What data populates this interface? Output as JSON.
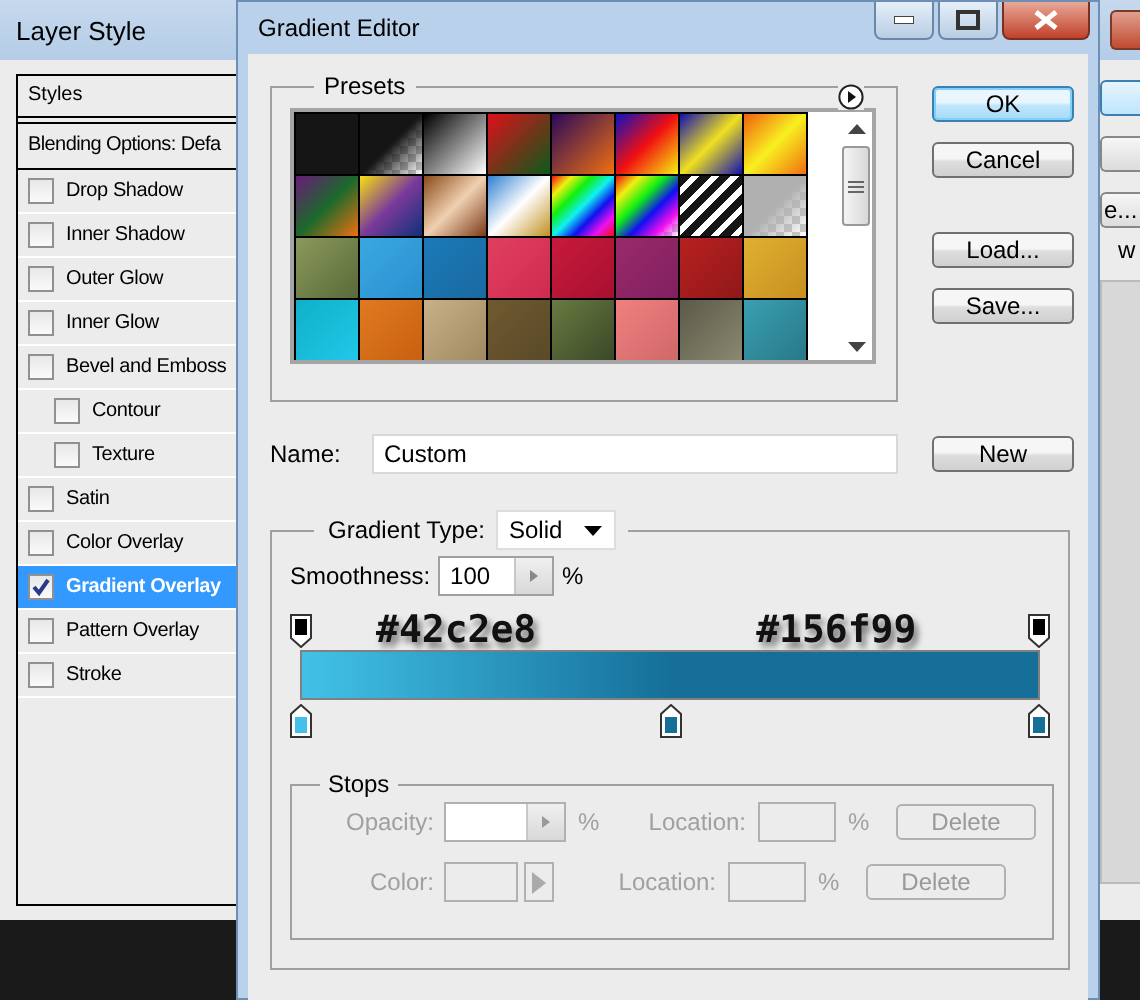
{
  "layer_style": {
    "title": "Layer Style",
    "styles_label": "Styles",
    "blending_options": "Blending Options: Defa",
    "effects": [
      {
        "label": "Drop Shadow",
        "kind": "effect",
        "checked": false,
        "selected": false
      },
      {
        "label": "Inner Shadow",
        "kind": "effect",
        "checked": false,
        "selected": false
      },
      {
        "label": "Outer Glow",
        "kind": "effect",
        "checked": false,
        "selected": false
      },
      {
        "label": "Inner Glow",
        "kind": "effect",
        "checked": false,
        "selected": false
      },
      {
        "label": "Bevel and Emboss",
        "kind": "effect",
        "checked": false,
        "selected": false
      },
      {
        "label": "Contour",
        "kind": "sub",
        "checked": false,
        "selected": false
      },
      {
        "label": "Texture",
        "kind": "sub",
        "checked": false,
        "selected": false
      },
      {
        "label": "Satin",
        "kind": "effect",
        "checked": false,
        "selected": false
      },
      {
        "label": "Color Overlay",
        "kind": "effect",
        "checked": false,
        "selected": false
      },
      {
        "label": "Gradient Overlay",
        "kind": "effect",
        "checked": true,
        "selected": true
      },
      {
        "label": "Pattern Overlay",
        "kind": "effect",
        "checked": false,
        "selected": false
      },
      {
        "label": "Stroke",
        "kind": "effect",
        "checked": false,
        "selected": false
      }
    ],
    "side_button": "e...",
    "side_text": "w"
  },
  "gradient_editor": {
    "title": "Gradient Editor",
    "presets": {
      "title": "Presets"
    },
    "buttons": [
      {
        "label": "OK",
        "default": true
      },
      {
        "label": "Cancel",
        "default": false
      },
      {
        "label": "Load...",
        "default": false
      },
      {
        "label": "Save...",
        "default": false
      }
    ],
    "name": {
      "label": "Name:",
      "value": "Custom",
      "button": "New"
    },
    "gradient": {
      "type_label": "Gradient Type:",
      "type_value": "Solid",
      "smoothness_label": "Smoothness:",
      "smoothness_value": "100",
      "unit": "%",
      "annotations": [
        "#42c2e8",
        "#156f99"
      ],
      "opacity_stops": [
        {
          "level": 0,
          "color": "#000000"
        },
        {
          "level": 1,
          "color": "#000000"
        }
      ],
      "color_stops": [
        {
          "level": 0,
          "color": "#42c2e8"
        },
        {
          "level": 0.5,
          "color": "#156f99"
        },
        {
          "level": 1,
          "color": "#156f99"
        }
      ]
    },
    "stops": {
      "title": "Stops",
      "disabled": true,
      "rows": [
        {
          "kind": "spinner",
          "label": "Opacity:",
          "unit": "%",
          "location_label": "Location:",
          "location_unit": "%",
          "button": "Delete"
        },
        {
          "kind": "color",
          "label": "Color:",
          "location_label": "Location:",
          "location_unit": "%",
          "button": "Delete"
        }
      ]
    }
  }
}
